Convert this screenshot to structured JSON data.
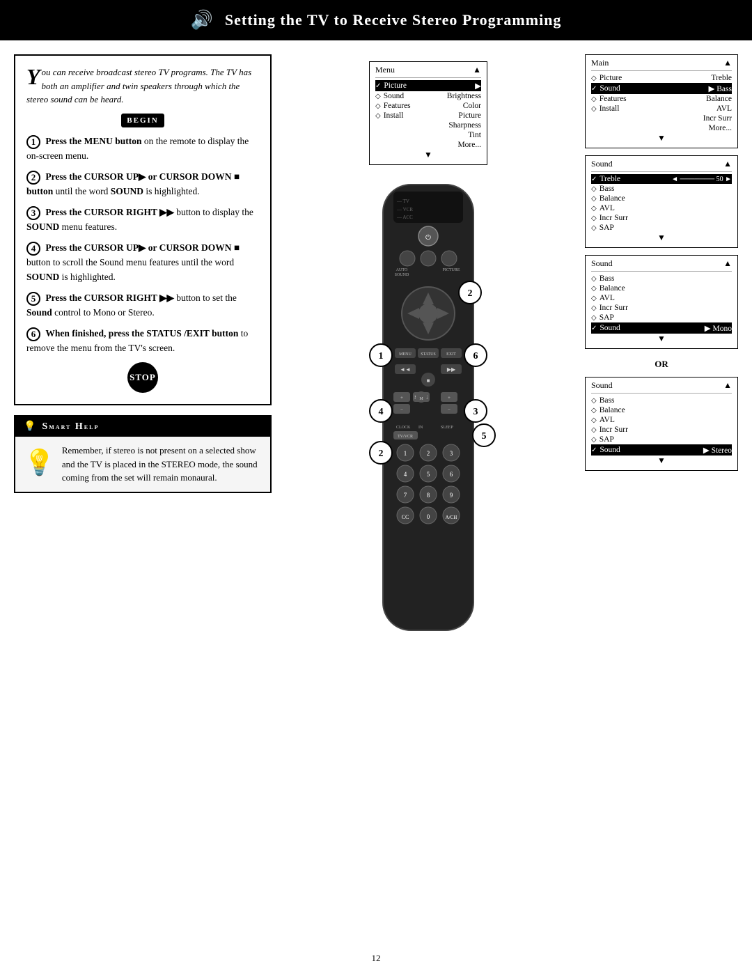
{
  "header": {
    "title": "Setting the TV to Receive Stereo Programming",
    "icon": "🔊"
  },
  "intro": {
    "bigY": "Y",
    "text": "ou can receive broadcast stereo TV programs. The TV has both an amplifier and twin speakers through which the stereo sound can be heard."
  },
  "begin_label": "BEGIN",
  "steps": [
    {
      "number": "1",
      "text_parts": [
        {
          "bold": true,
          "text": "Press the MENU button"
        },
        {
          "bold": false,
          "text": " on the remote to display the on-screen menu."
        }
      ]
    },
    {
      "number": "2",
      "text_parts": [
        {
          "bold": true,
          "text": "Press the CURSOR UP▶ or CURSOR DOWN ■ button"
        },
        {
          "bold": false,
          "text": " until the word "
        },
        {
          "bold": true,
          "text": "SOUND"
        },
        {
          "bold": false,
          "text": " is highlighted."
        }
      ]
    },
    {
      "number": "3",
      "text_parts": [
        {
          "bold": true,
          "text": "Press the CURSOR RIGHT ▶▶"
        },
        {
          "bold": false,
          "text": " button to display the "
        },
        {
          "bold": true,
          "text": "SOUND"
        },
        {
          "bold": false,
          "text": " menu features."
        }
      ]
    },
    {
      "number": "4",
      "text_parts": [
        {
          "bold": true,
          "text": "Press the CURSOR UP▶ or CURSOR DOWN ■"
        },
        {
          "bold": false,
          "text": " button to scroll the Sound menu features until the word "
        },
        {
          "bold": true,
          "text": "SOUND"
        },
        {
          "bold": false,
          "text": " is highlighted."
        }
      ]
    },
    {
      "number": "5",
      "text_parts": [
        {
          "bold": true,
          "text": "Press the CURSOR RIGHT ▶▶"
        },
        {
          "bold": false,
          "text": " button to set the "
        },
        {
          "bold": true,
          "text": "Sound"
        },
        {
          "bold": false,
          "text": " control to Mono or Stereo."
        }
      ]
    },
    {
      "number": "6",
      "text_parts": [
        {
          "bold": true,
          "text": "When finished, press the STATUS /EXIT button"
        },
        {
          "bold": false,
          "text": " to remove the menu from the TV's screen."
        }
      ]
    }
  ],
  "stop_label": "STOP",
  "smart_help": {
    "title": "Smart Help",
    "text": "Remember, if stereo is not present on a selected show and the TV is placed in the STEREO mode, the sound coming from the set will remain monaural."
  },
  "menus": {
    "menu1": {
      "header": {
        "left": "Menu",
        "right": "▲"
      },
      "rows": [
        {
          "symbol": "✓",
          "label": "Picture",
          "right": "▶",
          "highlighted": false
        },
        {
          "symbol": "◇",
          "label": "Sound",
          "right": "Brightness",
          "highlighted": false
        },
        {
          "symbol": "◇",
          "label": "Features",
          "right": "Color",
          "highlighted": false
        },
        {
          "symbol": "◇",
          "label": "Install",
          "right": "Picture",
          "highlighted": false
        },
        {
          "symbol": "",
          "label": "",
          "right": "Sharpness",
          "highlighted": false
        },
        {
          "symbol": "",
          "label": "",
          "right": "Tint",
          "highlighted": false
        },
        {
          "symbol": "",
          "label": "",
          "right": "More...",
          "highlighted": false
        }
      ]
    },
    "menu2": {
      "header": {
        "left": "Main",
        "right": "▲"
      },
      "rows": [
        {
          "symbol": "◇",
          "label": "Picture",
          "right": "Treble",
          "highlighted": false
        },
        {
          "symbol": "✓",
          "label": "Sound",
          "right": "Bass",
          "arrow": "▶",
          "highlighted": true
        },
        {
          "symbol": "◇",
          "label": "Features",
          "right": "Balance",
          "highlighted": false
        },
        {
          "symbol": "◇",
          "label": "Install",
          "right": "AVL",
          "highlighted": false
        },
        {
          "symbol": "",
          "label": "",
          "right": "Incr Surr",
          "highlighted": false
        },
        {
          "symbol": "",
          "label": "",
          "right": "More...",
          "highlighted": false
        }
      ]
    },
    "menu3": {
      "header": {
        "left": "Sound",
        "right": "▲"
      },
      "rows": [
        {
          "symbol": "✓",
          "label": "Treble",
          "right": "◄ ─────── 50 ►",
          "highlighted": false
        },
        {
          "symbol": "◇",
          "label": "Bass",
          "right": "",
          "highlighted": false
        },
        {
          "symbol": "◇",
          "label": "Balance",
          "right": "",
          "highlighted": false
        },
        {
          "symbol": "◇",
          "label": "AVL",
          "right": "",
          "highlighted": false
        },
        {
          "symbol": "◇",
          "label": "Incr Surr",
          "right": "",
          "highlighted": false
        },
        {
          "symbol": "◇",
          "label": "SAP",
          "right": "",
          "highlighted": false
        }
      ]
    },
    "menu4": {
      "header": {
        "left": "Sound",
        "right": "▲"
      },
      "rows": [
        {
          "symbol": "◇",
          "label": "Bass",
          "right": "",
          "highlighted": false
        },
        {
          "symbol": "◇",
          "label": "Balance",
          "right": "",
          "highlighted": false
        },
        {
          "symbol": "◇",
          "label": "AVL",
          "right": "",
          "highlighted": false
        },
        {
          "symbol": "◇",
          "label": "Incr Surr",
          "right": "",
          "highlighted": false
        },
        {
          "symbol": "◇",
          "label": "SAP",
          "right": "",
          "highlighted": false
        },
        {
          "symbol": "✓",
          "label": "Sound",
          "right": "Mono",
          "arrow": "▶",
          "highlighted": true
        }
      ]
    },
    "or_label": "OR",
    "menu5": {
      "header": {
        "left": "Sound",
        "right": "▲"
      },
      "rows": [
        {
          "symbol": "◇",
          "label": "Bass",
          "right": "",
          "highlighted": false
        },
        {
          "symbol": "◇",
          "label": "Balance",
          "right": "",
          "highlighted": false
        },
        {
          "symbol": "◇",
          "label": "AVL",
          "right": "",
          "highlighted": false
        },
        {
          "symbol": "◇",
          "label": "Incr Surr",
          "right": "",
          "highlighted": false
        },
        {
          "symbol": "◇",
          "label": "SAP",
          "right": "",
          "highlighted": false
        },
        {
          "symbol": "✓",
          "label": "Sound",
          "right": "Stereo",
          "arrow": "▶",
          "highlighted": true
        }
      ]
    }
  },
  "page_number": "12"
}
